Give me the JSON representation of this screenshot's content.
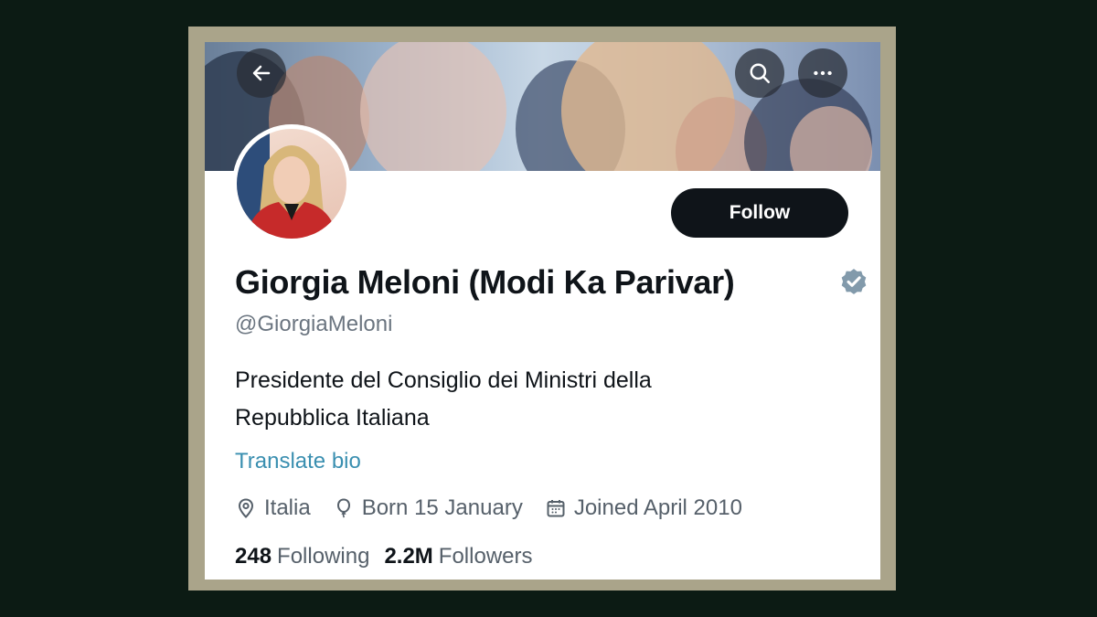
{
  "profile": {
    "name": "Giorgia Meloni (Modi Ka Parivar)",
    "handle": "@GiorgiaMeloni",
    "bio_line1": "Presidente del Consiglio dei Ministri della",
    "bio_line2": "Repubblica Italiana",
    "translate_label": "Translate bio",
    "verified": true
  },
  "header": {
    "back_icon": "arrow-left-icon",
    "search_icon": "search-icon",
    "more_icon": "more-horizontal-icon"
  },
  "actions": {
    "follow_label": "Follow"
  },
  "meta": {
    "location": "Italia",
    "birthday": "Born 15 January",
    "joined": "Joined April 2010"
  },
  "stats": {
    "following_count": "248",
    "following_label": "Following",
    "followers_count": "2.2M",
    "followers_label": "Followers"
  },
  "colors": {
    "background": "#0c1b14",
    "frame": "#aaa48a",
    "follow_button": "#0f1419",
    "link": "#3a8fb0",
    "verified": "#829aab"
  }
}
